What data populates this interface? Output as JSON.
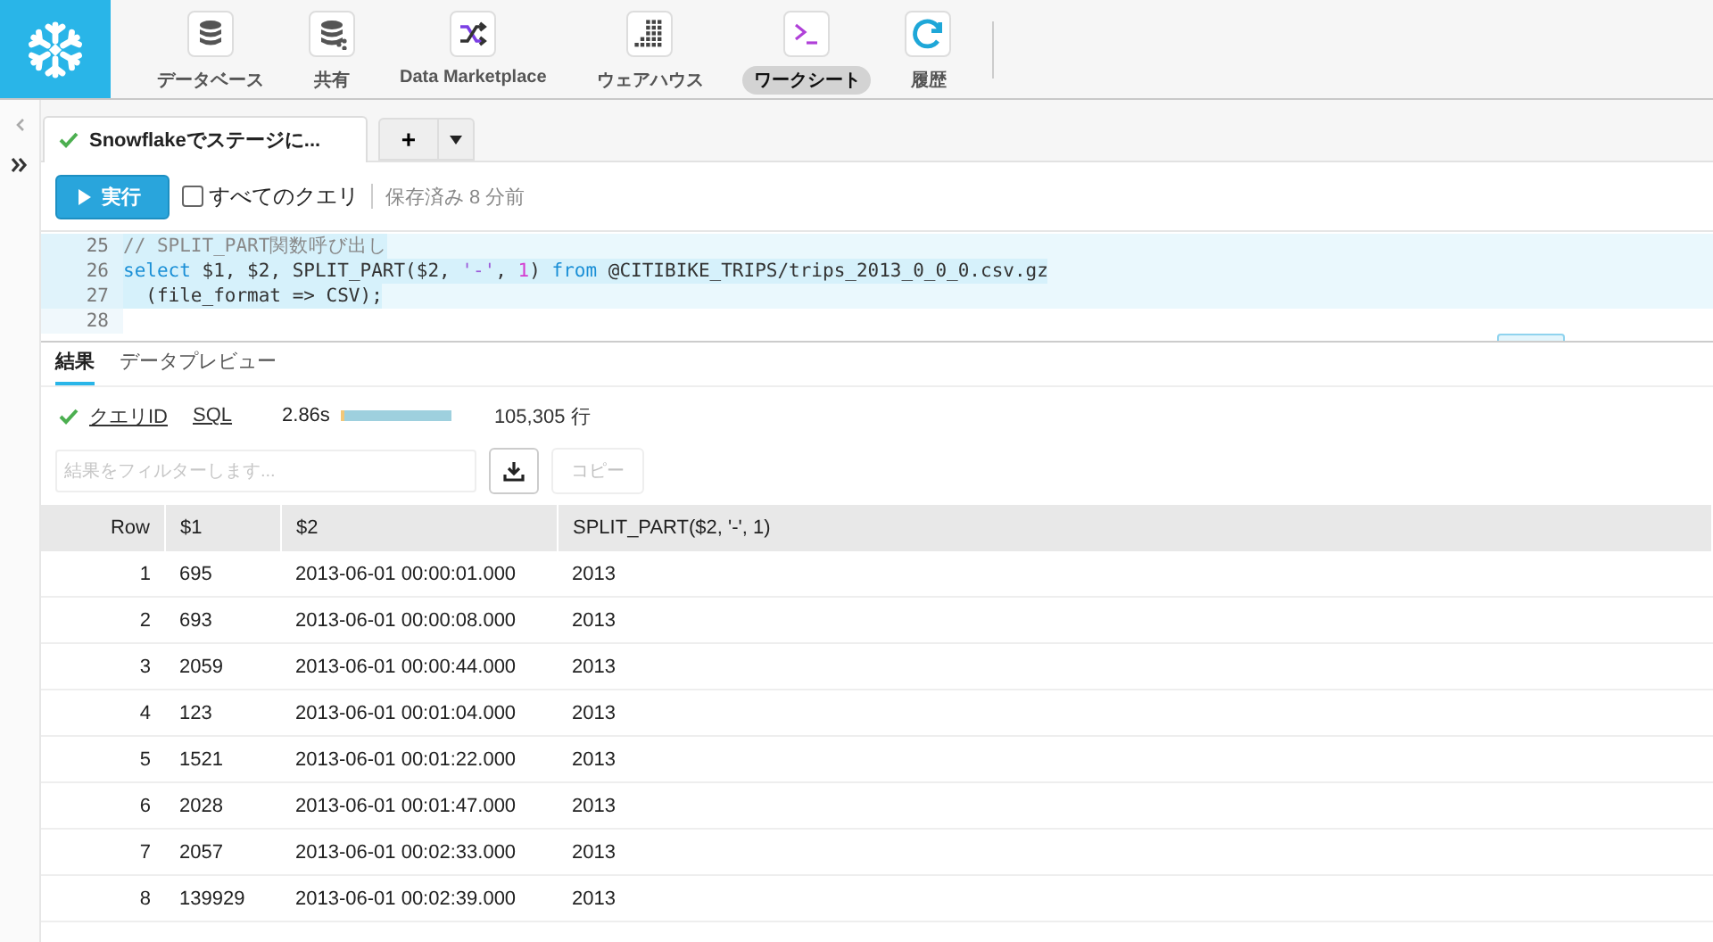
{
  "nav": {
    "items": [
      {
        "label": "データベース",
        "kind": "database",
        "selected": false
      },
      {
        "label": "共有",
        "kind": "share",
        "selected": false
      },
      {
        "label": "Data Marketplace",
        "kind": "shuffle",
        "selected": false
      },
      {
        "label": "ウェアハウス",
        "kind": "grid",
        "selected": false
      },
      {
        "label": "ワークシート",
        "kind": "terminal",
        "selected": true
      },
      {
        "label": "履歴",
        "kind": "history",
        "selected": false
      }
    ]
  },
  "worksheet_tabs": [
    {
      "label": "Snowflakeでステージに...",
      "selected": true
    }
  ],
  "add_tab": "+",
  "toolbar": {
    "run_button": "実行",
    "all_queries": {
      "label": "すべてのクエリ",
      "checked": false
    },
    "saved_status": "保存済み 8 分前"
  },
  "editor": {
    "lines": [
      {
        "number": "25",
        "highlighted": true,
        "tokens": [
          {
            "kind": "comment",
            "text": "// SPLIT_PART関数呼び出し"
          }
        ]
      },
      {
        "number": "26",
        "highlighted": true,
        "tokens": [
          {
            "kind": "keyword",
            "text": "select"
          },
          {
            "kind": "plain",
            "text": " $1, $2, SPLIT_PART($2, "
          },
          {
            "kind": "string",
            "text": "'-'"
          },
          {
            "kind": "plain",
            "text": ", "
          },
          {
            "kind": "number",
            "text": "1"
          },
          {
            "kind": "plain",
            "text": ") "
          },
          {
            "kind": "keyword",
            "text": "from"
          },
          {
            "kind": "plain",
            "text": " @CITIBIKE_TRIPS/trips_2013_0_0_0.csv.gz"
          }
        ]
      },
      {
        "number": "27",
        "highlighted": true,
        "tokens": [
          {
            "kind": "plain",
            "text": "  (file_format => CSV);"
          }
        ]
      },
      {
        "number": "28",
        "highlighted": false
      }
    ]
  },
  "result_tabs": [
    {
      "label": "結果",
      "selected": true
    },
    {
      "label": "データプレビュー",
      "selected": false
    }
  ],
  "result_status": {
    "query_id": "クエリID",
    "sql": "SQL",
    "duration": "2.86s",
    "row_count": "105,305 行"
  },
  "filter": {
    "placeholder": "結果をフィルターします..."
  },
  "copy_button": {
    "label": "コピー",
    "disabled": true
  },
  "table": {
    "columns": [
      "Row",
      "$1",
      "$2",
      "SPLIT_PART($2, '-', 1)"
    ],
    "rows": [
      [
        "1",
        "695",
        "2013-06-01 00:00:01.000",
        "2013"
      ],
      [
        "2",
        "693",
        "2013-06-01 00:00:08.000",
        "2013"
      ],
      [
        "3",
        "2059",
        "2013-06-01 00:00:44.000",
        "2013"
      ],
      [
        "4",
        "123",
        "2013-06-01 00:01:04.000",
        "2013"
      ],
      [
        "5",
        "1521",
        "2013-06-01 00:01:22.000",
        "2013"
      ],
      [
        "6",
        "2028",
        "2013-06-01 00:01:47.000",
        "2013"
      ],
      [
        "7",
        "2057",
        "2013-06-01 00:02:33.000",
        "2013"
      ],
      [
        "8",
        "139929",
        "2013-06-01 00:02:39.000",
        "2013"
      ]
    ]
  }
}
